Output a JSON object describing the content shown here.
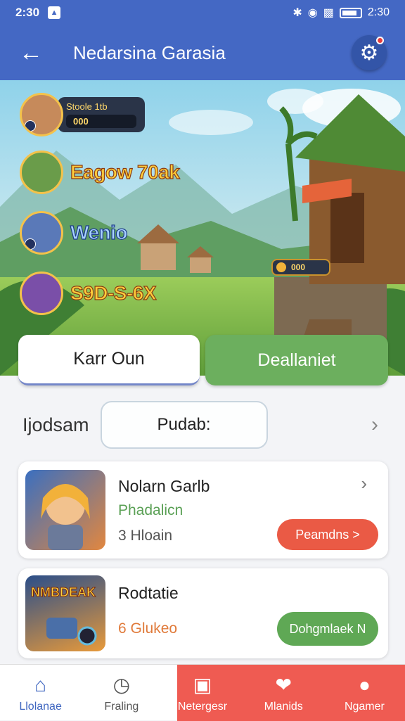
{
  "status_bar": {
    "time_left": "2:30",
    "time_right": "2:30"
  },
  "app_bar": {
    "title": "Nedarsina Garasia",
    "back_icon": "arrow-left-icon",
    "settings_icon": "gear-icon"
  },
  "hero": {
    "players": [
      {
        "label": "Stoole 1tb",
        "value": "000"
      },
      {
        "name": "Eagow 70ak"
      },
      {
        "name": "Wenio"
      },
      {
        "name": "S9D-S-6X"
      }
    ],
    "coin_value": "000"
  },
  "tabs": [
    {
      "label": "Karr Oun"
    },
    {
      "label": "Deallaniet"
    }
  ],
  "filter": {
    "label": "Ijodsam",
    "pill": "Pudab:"
  },
  "cards": [
    {
      "title": "Nolarn Garlb",
      "subtitle": "Phadalicn",
      "meta": "3 Hloain",
      "button": "Peamdns >"
    },
    {
      "title": "Rodtatie",
      "meta": "6 Glukeo",
      "button": "Dohgmlaek N",
      "thumb_text": "NMBDEAK"
    }
  ],
  "bottom_nav": [
    {
      "label": "Llolanae",
      "icon": "home-icon"
    },
    {
      "label": "Fraling",
      "icon": "clock-icon"
    },
    {
      "label": "Netergesr",
      "icon": "bag-icon"
    },
    {
      "label": "Mlanids",
      "icon": "heart-icon"
    },
    {
      "label": "Ngamer",
      "icon": "person-icon"
    }
  ],
  "colors": {
    "primary": "#4468c4",
    "green": "#6caf5e",
    "red": "#ea5a45",
    "nav_active": "#ef5b52"
  }
}
